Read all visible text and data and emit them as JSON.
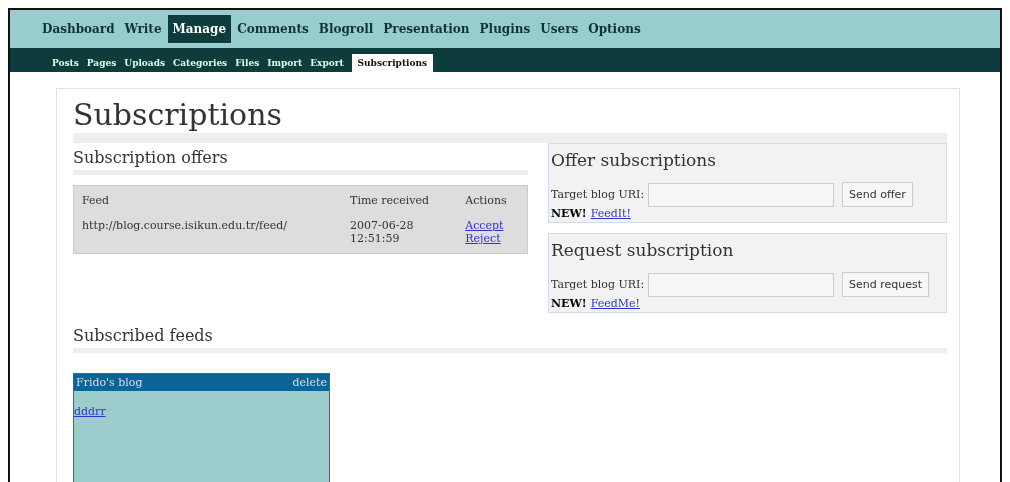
{
  "main_nav": [
    {
      "label": "Dashboard",
      "selected": false
    },
    {
      "label": "Write",
      "selected": false
    },
    {
      "label": "Manage",
      "selected": true
    },
    {
      "label": "Comments",
      "selected": false
    },
    {
      "label": "Blogroll",
      "selected": false
    },
    {
      "label": "Presentation",
      "selected": false
    },
    {
      "label": "Plugins",
      "selected": false
    },
    {
      "label": "Users",
      "selected": false
    },
    {
      "label": "Options",
      "selected": false
    }
  ],
  "sub_nav": [
    {
      "label": "Posts",
      "selected": false
    },
    {
      "label": "Pages",
      "selected": false
    },
    {
      "label": "Uploads",
      "selected": false
    },
    {
      "label": "Categories",
      "selected": false
    },
    {
      "label": "Files",
      "selected": false
    },
    {
      "label": "Import",
      "selected": false
    },
    {
      "label": "Export",
      "selected": false
    },
    {
      "label": "Subscriptions",
      "selected": true
    }
  ],
  "page_title": "Subscriptions",
  "offers": {
    "heading": "Subscription offers",
    "columns": [
      "Feed",
      "Time received",
      "Actions"
    ],
    "rows": [
      {
        "feed": "http://blog.course.isikun.edu.tr/feed/",
        "time": [
          "2007-06-28",
          "12:51:59"
        ],
        "actions": [
          "Accept",
          "Reject"
        ]
      }
    ]
  },
  "panels": [
    {
      "heading": "Offer subscriptions",
      "label": "Target blog URI:",
      "button": "Send offer",
      "new_label": "NEW!",
      "link": "FeedIt!"
    },
    {
      "heading": "Request subscription",
      "label": "Target blog URI:",
      "button": "Send request",
      "new_label": "NEW!",
      "link": "FeedMe!"
    }
  ],
  "subscribed": {
    "heading": "Subscribed feeds",
    "feeds": [
      {
        "title": "Frido's blog",
        "action": "delete",
        "items": [
          "dddrr"
        ]
      }
    ]
  }
}
